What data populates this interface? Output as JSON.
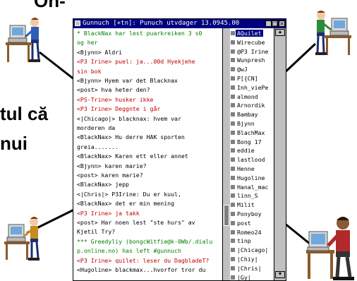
{
  "slide": {
    "heading_fragment": "On-",
    "line1_fragment": "tul că",
    "line2_fragment": "nui"
  },
  "window": {
    "title": "Gunnuch [+tn]: Punuch utvdager 13.0945.00",
    "controls": {
      "minimize": "_",
      "maximize": "□",
      "close": "×"
    }
  },
  "colors": {
    "titlebar": "#000080",
    "chat_red": "#c00000",
    "chat_green": "#008000",
    "nick_selected": "#000080"
  },
  "chat": [
    {
      "text": "* BlackNax har lest puarkreiken 3 s0",
      "color": "#008000"
    },
    {
      "text": "   og her",
      "color": "#008000"
    },
    {
      "text": "<Bjynn> Aldri",
      "color": "#000000"
    },
    {
      "text": "<P3 Irine> puel: ja...00d Hyekjehe",
      "color": "#c00000"
    },
    {
      "text": "   sin bok",
      "color": "#c00000"
    },
    {
      "text": "<Bjynn> Hyem var det Blacknax",
      "color": "#000000"
    },
    {
      "text": "<post> hva heter den?",
      "color": "#000000"
    },
    {
      "text": "<PS-Trine> husker ikke",
      "color": "#c00000"
    },
    {
      "text": "<P3 Irine> Deggnte i går",
      "color": "#c00000"
    },
    {
      "text": "<|Chicago|> blacknax: hvem var",
      "color": "#000000"
    },
    {
      "text": "   morderen da",
      "color": "#000000"
    },
    {
      "text": "<BlackNax> Hu derre HAK sporten",
      "color": "#000000"
    },
    {
      "text": "   greia.......",
      "color": "#000000"
    },
    {
      "text": "<BlackNax> Karen ett eller annet",
      "color": "#000000"
    },
    {
      "text": "<Bjynn> karen marie?",
      "color": "#000000"
    },
    {
      "text": "<post> karen marie?",
      "color": "#000000"
    },
    {
      "text": "<BlackNax> jepp",
      "color": "#000000"
    },
    {
      "text": "<|Chris|> P3Irine: Du er kuul,",
      "color": "#000000"
    },
    {
      "text": "<BlackNax> det er min mening",
      "color": "#000000"
    },
    {
      "text": "<P3 Irine> ja takk",
      "color": "#c00000"
    },
    {
      "text": "<post> Har noen lest \"ste hurs\" av",
      "color": "#000000"
    },
    {
      "text": "   Kjetil Try?",
      "color": "#000000"
    },
    {
      "text": "*** Greedyliy (bongcWitfie@k-0Wb/.dialu",
      "color": "#008000"
    },
    {
      "text": "   p.online.no) has left #gunnuch",
      "color": "#008000"
    },
    {
      "text": "<P3 Irine> quilet: leser du DagbladeT?",
      "color": "#c00000"
    },
    {
      "text": "<Hugoline> blackmax...hvorfor tror du",
      "color": "#000000"
    }
  ],
  "nicklist": [
    {
      "nick": "AQuilet",
      "selected": true
    },
    {
      "nick": "Wirecube",
      "selected": false
    },
    {
      "nick": "@P3 Irine",
      "selected": false
    },
    {
      "nick": "Wunpresh",
      "selected": false
    },
    {
      "nick": "@wJ",
      "selected": false
    },
    {
      "nick": "P[{CN]",
      "selected": false
    },
    {
      "nick": "Inh_viePe",
      "selected": false
    },
    {
      "nick": "almond",
      "selected": false
    },
    {
      "nick": "Arnordik",
      "selected": false
    },
    {
      "nick": "Bambay",
      "selected": false
    },
    {
      "nick": "Bjynn",
      "selected": false
    },
    {
      "nick": "BlachMax",
      "selected": false
    },
    {
      "nick": "Bong 17",
      "selected": false
    },
    {
      "nick": "eddie",
      "selected": false
    },
    {
      "nick": "lastlood",
      "selected": false
    },
    {
      "nick": "Henne",
      "selected": false
    },
    {
      "nick": "Hugoline",
      "selected": false
    },
    {
      "nick": "Hanal_mac",
      "selected": false
    },
    {
      "nick": "linn_S",
      "selected": false
    },
    {
      "nick": "Milit",
      "selected": false
    },
    {
      "nick": "Ponyboy",
      "selected": false
    },
    {
      "nick": "post",
      "selected": false
    },
    {
      "nick": "Romeo24",
      "selected": false
    },
    {
      "nick": "tinp",
      "selected": false
    },
    {
      "nick": "|Chicago|",
      "selected": false
    },
    {
      "nick": "|Chiy|",
      "selected": false
    },
    {
      "nick": "|Chris|",
      "selected": false
    },
    {
      "nick": "|Gy|",
      "selected": false
    }
  ]
}
